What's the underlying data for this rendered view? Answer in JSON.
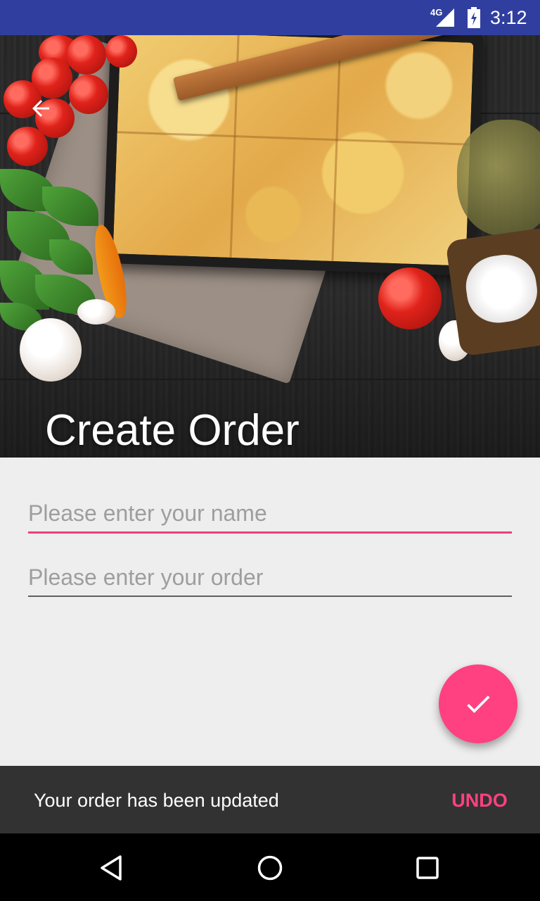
{
  "status_bar": {
    "network": "4G",
    "time": "3:12",
    "icons": [
      "cell-signal-icon",
      "battery-icon"
    ]
  },
  "header": {
    "title": "Create Order",
    "back_icon": "arrow-back-icon",
    "image": "lasagna-food-photo"
  },
  "form": {
    "name_field": {
      "value": "",
      "placeholder": "Please enter your name"
    },
    "order_field": {
      "value": "",
      "placeholder": "Please enter your order"
    }
  },
  "fab": {
    "icon": "check-icon"
  },
  "snackbar": {
    "message": "Your order has been updated",
    "action": "UNDO"
  },
  "nav_bar": {
    "icons": [
      "back-triangle-icon",
      "home-circle-icon",
      "recents-square-icon"
    ]
  },
  "colors": {
    "primary_dark": "#303f9f",
    "accent": "#ff4081",
    "background": "#eeeeee",
    "snackbar": "#323232"
  }
}
